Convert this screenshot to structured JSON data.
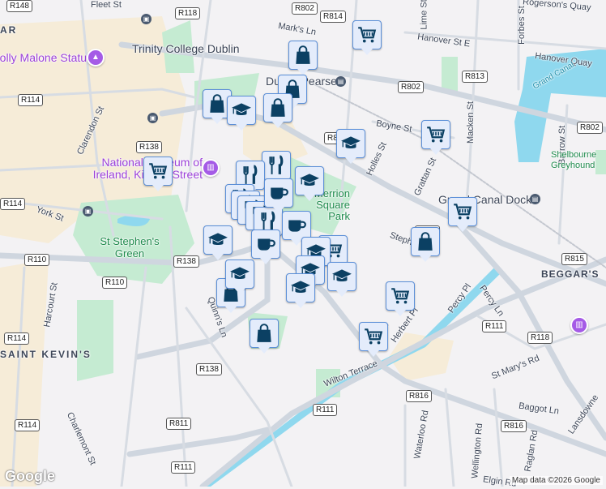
{
  "map": {
    "streets": [
      "Fleet St",
      "Mark's Ln",
      "Hanover St E",
      "Hanover Quay",
      "Rogerson's Quay",
      "Lime St",
      "Forbes St",
      "Macken St",
      "Barrow St",
      "Boyne St",
      "Holles St",
      "Grattan St",
      "Clarendon St",
      "York St",
      "Harcourt St",
      "Charlemont St",
      "Quinn's Ln",
      "Wilton Terrace",
      "Herbert Pl",
      "Percy Pl",
      "Percy Ln",
      "St Mary's Rd",
      "Baggot Ln",
      "Waterloo Rd",
      "Wellington Rd",
      "Raglan Rd",
      "Elgin Rd",
      "Lansdowne",
      "Stephen's",
      "Herb"
    ],
    "places": {
      "trinity": "Trinity College Dublin",
      "pearse": "Dublin Pearse",
      "molly": "Molly Malone Statue",
      "museum": "National Museum of Ireland, Kildare Street",
      "stephens_green": "St Stephen's Green",
      "merrion": "Merrion Square Park",
      "grand_canal_dock": "Grand Canal Dock",
      "grand_canal": "Grand Canal",
      "saint_kevins": "SAINT KEVIN'S",
      "beggars": "BEGGAR'S",
      "shelbourne": "Shelbourne Greyhound",
      "temple_bar": "AR"
    },
    "roads": [
      "R148",
      "R118",
      "R802",
      "R814",
      "R813",
      "R114",
      "R138",
      "R110",
      "R815",
      "R816",
      "R111",
      "R811"
    ],
    "attribution": "Map data ©2026 Google",
    "logo": "Google"
  },
  "markers": [
    "shopping-cart",
    "shopping-bag",
    "graduation-cap",
    "restaurant",
    "coffee-cup"
  ],
  "colors": {
    "marker_fill": "#e4ecfb",
    "marker_border": "#5b8fd8",
    "icon": "#0b4063",
    "park": "#c5ebd2",
    "water": "#8fd8ee",
    "poi": "#9b3fd8"
  }
}
